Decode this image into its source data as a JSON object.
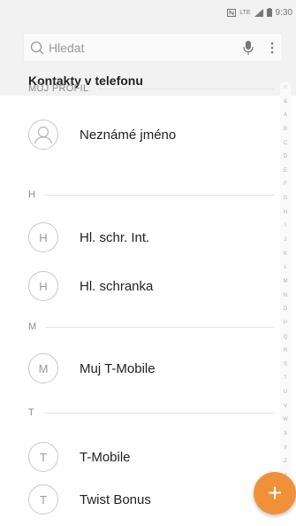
{
  "status_bar": {
    "time": "9:30",
    "network": "LTE"
  },
  "search": {
    "placeholder": "Hledat"
  },
  "list_title": "Kontakty v telefonu",
  "sections": [
    {
      "label": "MŮJ PROFIL"
    },
    {
      "label": "H"
    },
    {
      "label": "M"
    },
    {
      "label": "T"
    }
  ],
  "contacts": [
    {
      "initial": "",
      "name": "Neznámé jméno"
    },
    {
      "initial": "H",
      "name": "Hl. schr. Int."
    },
    {
      "initial": "H",
      "name": "Hl. schranka"
    },
    {
      "initial": "M",
      "name": "Muj T-Mobile"
    },
    {
      "initial": "T",
      "name": "T-Mobile"
    },
    {
      "initial": "T",
      "name": "Twist Bonus"
    }
  ],
  "index": [
    "☆",
    "&",
    "A",
    "B",
    "C",
    "D",
    "E",
    "F",
    "G",
    "H",
    "I",
    "J",
    "K",
    "L",
    "M",
    "N",
    "O",
    "P",
    "Q",
    "R",
    "S",
    "T",
    "U",
    "V",
    "W",
    "X",
    "Y",
    "Z",
    "#"
  ],
  "fab": {
    "label": "+",
    "color": "#f0913a"
  },
  "colors": {
    "accent": "#f0913a",
    "text": "#222222",
    "muted": "#8a8a8a"
  }
}
